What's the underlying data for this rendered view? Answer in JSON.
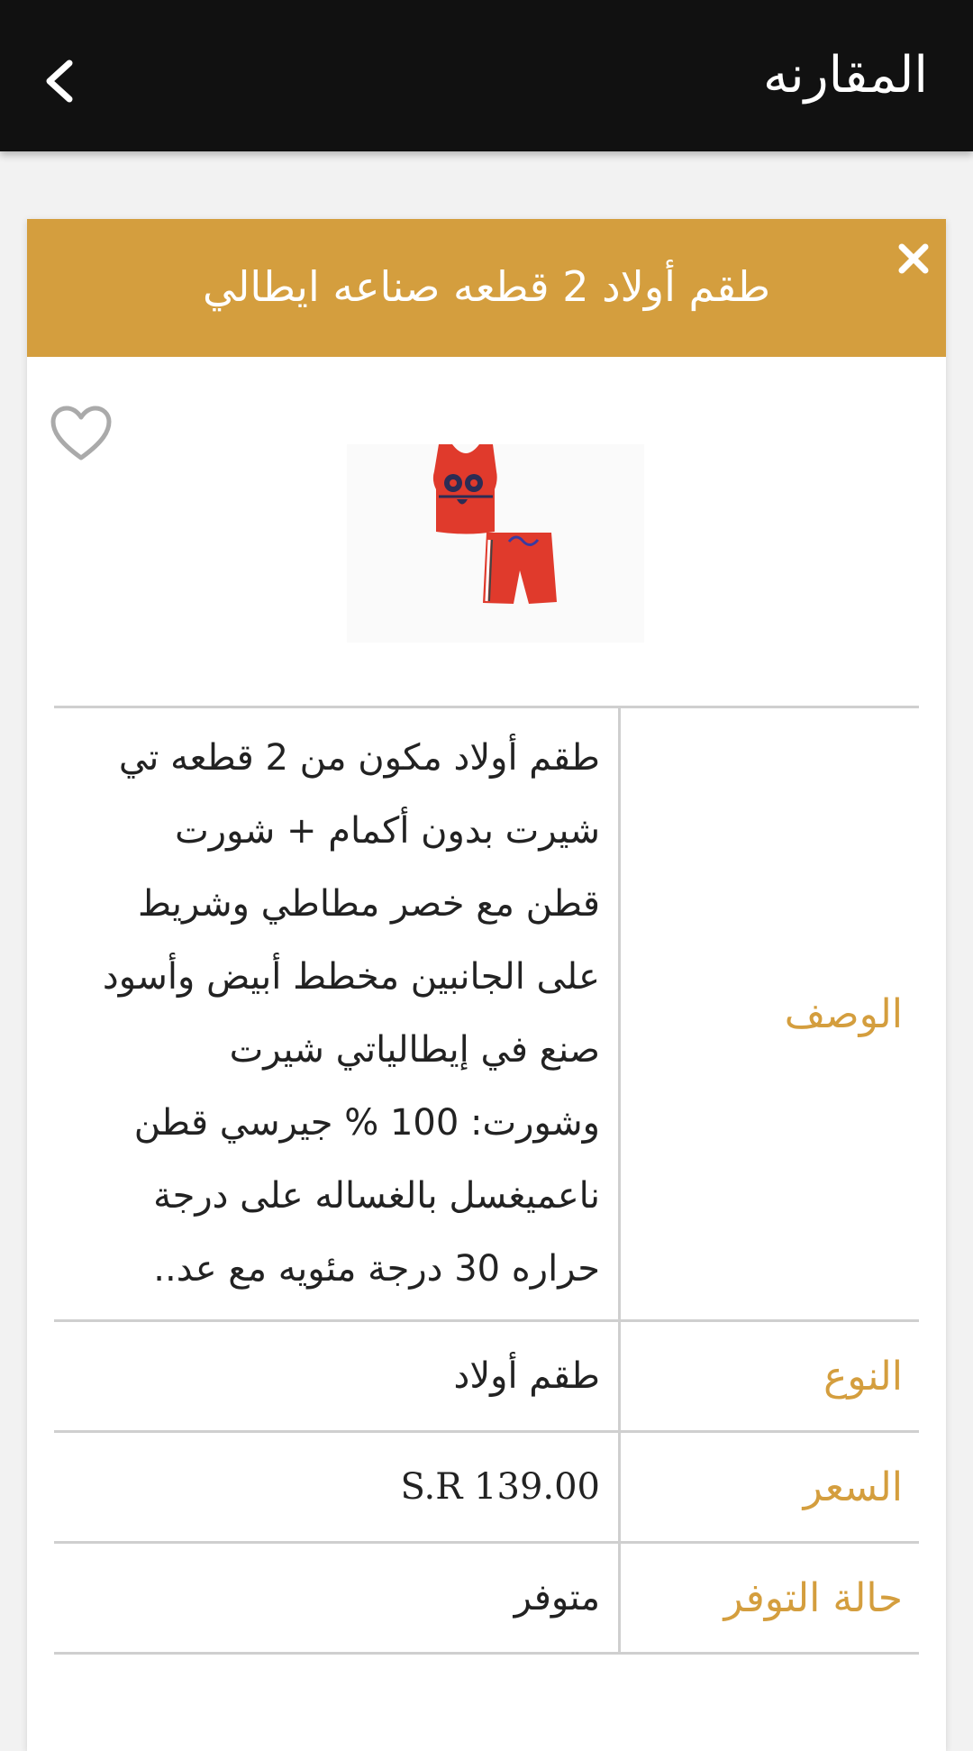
{
  "header": {
    "title": "المقارنه",
    "back_icon": "chevron-left-icon"
  },
  "product": {
    "title": "طقم أولاد 2 قطعه صناعه ايطالي",
    "header_color": "#d49e3e",
    "label_color": "#d49e3e"
  },
  "specs": {
    "description_label": "الوصف",
    "description_value": "طقم أولاد مكون من 2 قطعه تي شيرت بدون أكمام + شورت قطن مع خصر مطاطي وشريط على الجانبين مخطط أبيض وأسود صنع في إيطالياتي شيرت وشورت: 100 % جيرسي قطن ناعميغسل بالغساله على درجة حراره 30 درجة مئويه مع عد..",
    "type_label": "النوع",
    "type_value": "طقم أولاد",
    "price_label": "السعر",
    "price_value": "S.R 139.00",
    "availability_label": "حالة التوفر",
    "availability_value": "متوفر"
  }
}
